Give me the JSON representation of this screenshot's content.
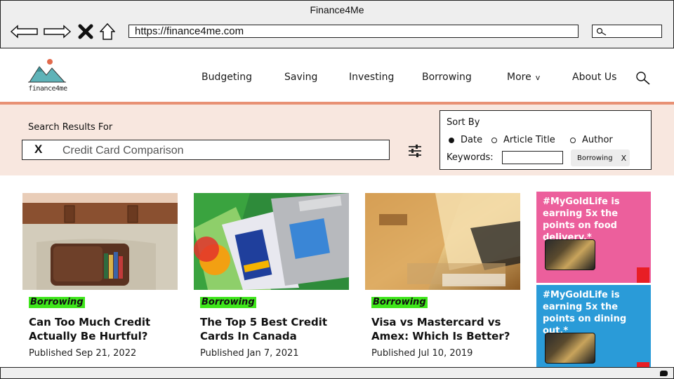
{
  "browser": {
    "window_title": "Finance4Me",
    "url": "https://finance4me.com",
    "search_value": ""
  },
  "site": {
    "logo_text": "finance4me",
    "nav": [
      {
        "label": "Budgeting"
      },
      {
        "label": "Saving"
      },
      {
        "label": "Investing"
      },
      {
        "label": "Borrowing"
      },
      {
        "label": "More",
        "chevron": "v"
      },
      {
        "label": "About Us"
      }
    ]
  },
  "search": {
    "label": "Search Results For",
    "clear": "X",
    "query": "Credit Card Comparison"
  },
  "sort": {
    "title": "Sort By",
    "options": [
      {
        "label": "Date",
        "selected": true
      },
      {
        "label": "Article Title",
        "selected": false
      },
      {
        "label": "Author",
        "selected": false
      }
    ],
    "keywords_label": "Keywords:",
    "keywords_value": "",
    "chip": {
      "label": "Borrowing",
      "remove": "X"
    }
  },
  "cards": [
    {
      "tag": "Borrowing",
      "title": "Can Too Much Credit Actually Be Hurtful?",
      "date": "Published Sep 21, 2022",
      "image": "wallet-in-pocket-photo"
    },
    {
      "tag": "Borrowing",
      "title": "The Top 5 Best Credit Cards In Canada",
      "date": "Published Jan 7, 2021",
      "image": "credit-cards-photo"
    },
    {
      "tag": "Borrowing",
      "title": "Visa vs Mastercard vs Amex: Which Is Better?",
      "date": "Published Jul 10, 2019",
      "image": "gold-visa-card-photo"
    }
  ],
  "ads": [
    {
      "text": "#MyGoldLife is earning 5x the points on food delivery.*",
      "bg": "#ec5f9c"
    },
    {
      "text": "#MyGoldLife is earning 5x the points on dining out.*",
      "bg": "#2a9bd8"
    }
  ],
  "colors": {
    "accent_rule": "#e89174",
    "search_band": "#f8e7df",
    "tag_highlight": "#3fe61b"
  }
}
